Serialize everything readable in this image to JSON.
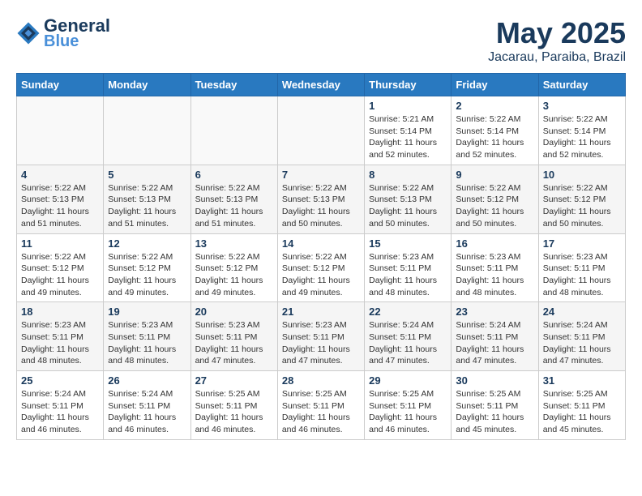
{
  "header": {
    "logo_line1": "General",
    "logo_line2": "Blue",
    "month": "May 2025",
    "location": "Jacarau, Paraiba, Brazil"
  },
  "weekdays": [
    "Sunday",
    "Monday",
    "Tuesday",
    "Wednesday",
    "Thursday",
    "Friday",
    "Saturday"
  ],
  "weeks": [
    [
      {
        "day": "",
        "info": ""
      },
      {
        "day": "",
        "info": ""
      },
      {
        "day": "",
        "info": ""
      },
      {
        "day": "",
        "info": ""
      },
      {
        "day": "1",
        "info": "Sunrise: 5:21 AM\nSunset: 5:14 PM\nDaylight: 11 hours\nand 52 minutes."
      },
      {
        "day": "2",
        "info": "Sunrise: 5:22 AM\nSunset: 5:14 PM\nDaylight: 11 hours\nand 52 minutes."
      },
      {
        "day": "3",
        "info": "Sunrise: 5:22 AM\nSunset: 5:14 PM\nDaylight: 11 hours\nand 52 minutes."
      }
    ],
    [
      {
        "day": "4",
        "info": "Sunrise: 5:22 AM\nSunset: 5:13 PM\nDaylight: 11 hours\nand 51 minutes."
      },
      {
        "day": "5",
        "info": "Sunrise: 5:22 AM\nSunset: 5:13 PM\nDaylight: 11 hours\nand 51 minutes."
      },
      {
        "day": "6",
        "info": "Sunrise: 5:22 AM\nSunset: 5:13 PM\nDaylight: 11 hours\nand 51 minutes."
      },
      {
        "day": "7",
        "info": "Sunrise: 5:22 AM\nSunset: 5:13 PM\nDaylight: 11 hours\nand 50 minutes."
      },
      {
        "day": "8",
        "info": "Sunrise: 5:22 AM\nSunset: 5:13 PM\nDaylight: 11 hours\nand 50 minutes."
      },
      {
        "day": "9",
        "info": "Sunrise: 5:22 AM\nSunset: 5:12 PM\nDaylight: 11 hours\nand 50 minutes."
      },
      {
        "day": "10",
        "info": "Sunrise: 5:22 AM\nSunset: 5:12 PM\nDaylight: 11 hours\nand 50 minutes."
      }
    ],
    [
      {
        "day": "11",
        "info": "Sunrise: 5:22 AM\nSunset: 5:12 PM\nDaylight: 11 hours\nand 49 minutes."
      },
      {
        "day": "12",
        "info": "Sunrise: 5:22 AM\nSunset: 5:12 PM\nDaylight: 11 hours\nand 49 minutes."
      },
      {
        "day": "13",
        "info": "Sunrise: 5:22 AM\nSunset: 5:12 PM\nDaylight: 11 hours\nand 49 minutes."
      },
      {
        "day": "14",
        "info": "Sunrise: 5:22 AM\nSunset: 5:12 PM\nDaylight: 11 hours\nand 49 minutes."
      },
      {
        "day": "15",
        "info": "Sunrise: 5:23 AM\nSunset: 5:11 PM\nDaylight: 11 hours\nand 48 minutes."
      },
      {
        "day": "16",
        "info": "Sunrise: 5:23 AM\nSunset: 5:11 PM\nDaylight: 11 hours\nand 48 minutes."
      },
      {
        "day": "17",
        "info": "Sunrise: 5:23 AM\nSunset: 5:11 PM\nDaylight: 11 hours\nand 48 minutes."
      }
    ],
    [
      {
        "day": "18",
        "info": "Sunrise: 5:23 AM\nSunset: 5:11 PM\nDaylight: 11 hours\nand 48 minutes."
      },
      {
        "day": "19",
        "info": "Sunrise: 5:23 AM\nSunset: 5:11 PM\nDaylight: 11 hours\nand 48 minutes."
      },
      {
        "day": "20",
        "info": "Sunrise: 5:23 AM\nSunset: 5:11 PM\nDaylight: 11 hours\nand 47 minutes."
      },
      {
        "day": "21",
        "info": "Sunrise: 5:23 AM\nSunset: 5:11 PM\nDaylight: 11 hours\nand 47 minutes."
      },
      {
        "day": "22",
        "info": "Sunrise: 5:24 AM\nSunset: 5:11 PM\nDaylight: 11 hours\nand 47 minutes."
      },
      {
        "day": "23",
        "info": "Sunrise: 5:24 AM\nSunset: 5:11 PM\nDaylight: 11 hours\nand 47 minutes."
      },
      {
        "day": "24",
        "info": "Sunrise: 5:24 AM\nSunset: 5:11 PM\nDaylight: 11 hours\nand 47 minutes."
      }
    ],
    [
      {
        "day": "25",
        "info": "Sunrise: 5:24 AM\nSunset: 5:11 PM\nDaylight: 11 hours\nand 46 minutes."
      },
      {
        "day": "26",
        "info": "Sunrise: 5:24 AM\nSunset: 5:11 PM\nDaylight: 11 hours\nand 46 minutes."
      },
      {
        "day": "27",
        "info": "Sunrise: 5:25 AM\nSunset: 5:11 PM\nDaylight: 11 hours\nand 46 minutes."
      },
      {
        "day": "28",
        "info": "Sunrise: 5:25 AM\nSunset: 5:11 PM\nDaylight: 11 hours\nand 46 minutes."
      },
      {
        "day": "29",
        "info": "Sunrise: 5:25 AM\nSunset: 5:11 PM\nDaylight: 11 hours\nand 46 minutes."
      },
      {
        "day": "30",
        "info": "Sunrise: 5:25 AM\nSunset: 5:11 PM\nDaylight: 11 hours\nand 45 minutes."
      },
      {
        "day": "31",
        "info": "Sunrise: 5:25 AM\nSunset: 5:11 PM\nDaylight: 11 hours\nand 45 minutes."
      }
    ]
  ]
}
